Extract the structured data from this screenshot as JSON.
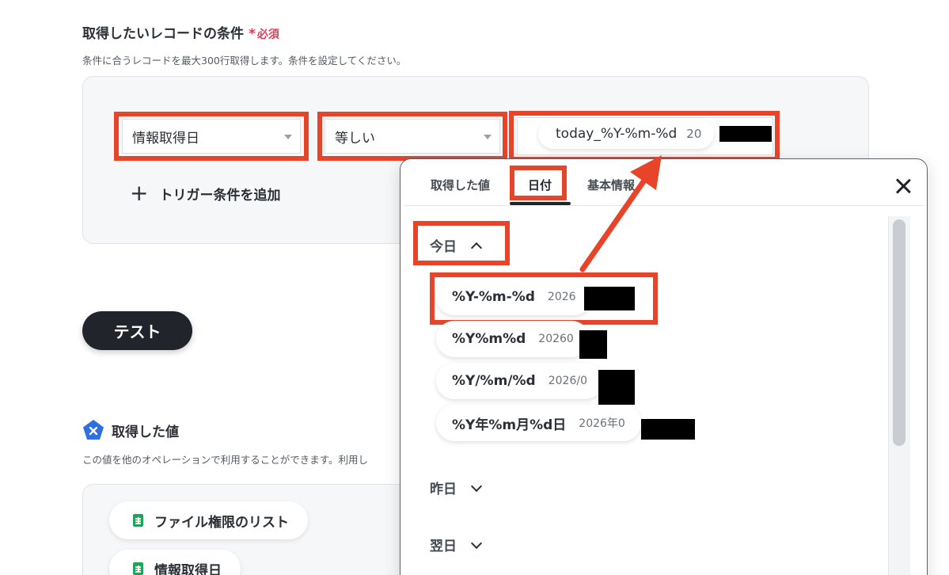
{
  "section": {
    "title": "取得したいレコードの条件",
    "required_star": "*",
    "required_label": "必須",
    "description": "条件に合うレコードを最大300行取得します。条件を設定してください。"
  },
  "condition": {
    "field_value": "情報取得日",
    "operator_value": "等しい",
    "value_chip_main": "today_%Y-%m-%d",
    "value_chip_sub": "20",
    "add_trigger_label": "トリガー条件を追加"
  },
  "test_button_label": "テスト",
  "got_values": {
    "title": "取得した値",
    "description": "この値を他のオペレーションで利用することができます。利用し",
    "items": [
      "ファイル権限のリスト",
      "情報取得日"
    ]
  },
  "popup": {
    "tabs": [
      "取得した値",
      "日付",
      "基本情報"
    ],
    "active_tab": "日付",
    "groups": {
      "today": "今日",
      "yesterday": "昨日",
      "tomorrow": "翌日"
    },
    "formats": [
      {
        "main": "%Y-%m-%d",
        "sub": "2026"
      },
      {
        "main": "%Y%m%d",
        "sub": "20260"
      },
      {
        "main": "%Y/%m/%d",
        "sub": "2026/0"
      },
      {
        "main": "%Y年%m月%d日",
        "sub": "2026年0"
      }
    ]
  },
  "colors": {
    "highlight": "#e8442a",
    "button_dark": "#21242b",
    "required": "#e23d5a",
    "sheet_green": "#22a35a",
    "pentagon_blue": "#2f6fe0"
  }
}
